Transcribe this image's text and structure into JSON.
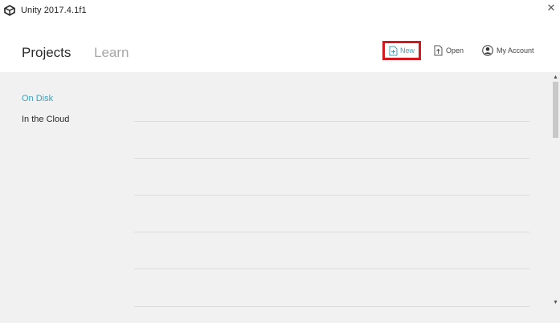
{
  "window": {
    "title": "Unity 2017.4.1f1",
    "close_glyph": "✕"
  },
  "tabs": [
    {
      "label": "Projects",
      "active": true
    },
    {
      "label": "Learn",
      "active": false
    }
  ],
  "toolbar": {
    "new_label": "New",
    "open_label": "Open",
    "account_label": "My Account"
  },
  "sidebar": {
    "items": [
      {
        "label": "On Disk",
        "active": true
      },
      {
        "label": "In the Cloud",
        "active": false
      }
    ]
  },
  "scrollbar": {
    "up_glyph": "▲",
    "down_glyph": "▼"
  },
  "colors": {
    "accent": "#3ea1bd",
    "highlight_border": "#d11a1f",
    "content_bg": "#f1f1f1"
  }
}
